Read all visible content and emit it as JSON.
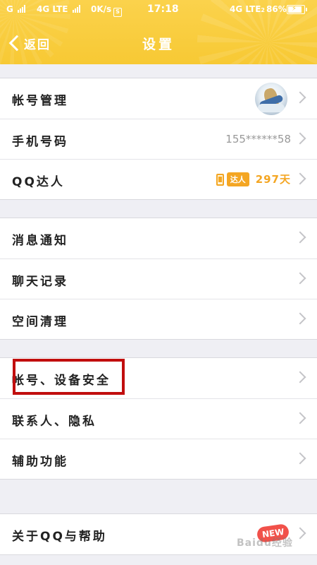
{
  "status_bar": {
    "carrier_left": "G",
    "network_left": "4G LTE",
    "speed": "0K/s",
    "sim_label": "S",
    "time": "17:18",
    "network_right": "4G LTE",
    "network_right_sub": "2",
    "battery": "86%"
  },
  "navbar": {
    "back_label": "返回",
    "title": "设置"
  },
  "groups": [
    {
      "items": [
        {
          "label": "帐号管理",
          "trailing": "avatar"
        },
        {
          "label": "手机号码",
          "value": "155******58"
        },
        {
          "label": "QQ达人",
          "badge": "达人",
          "days": "297天"
        }
      ]
    },
    {
      "items": [
        {
          "label": "消息通知"
        },
        {
          "label": "聊天记录"
        },
        {
          "label": "空间清理"
        }
      ]
    },
    {
      "items": [
        {
          "label": "帐号、设备安全",
          "highlighted": true
        },
        {
          "label": "联系人、隐私"
        },
        {
          "label": "辅助功能"
        }
      ]
    },
    {
      "items": [
        {
          "label": "关于QQ与帮助",
          "new_badge": "NEW"
        }
      ]
    }
  ],
  "colors": {
    "header": "#f7c934",
    "highlight": "#c10e0e",
    "daren_accent": "#f4a623",
    "new_badge": "#f1514a"
  },
  "watermark": "Baidu经验"
}
